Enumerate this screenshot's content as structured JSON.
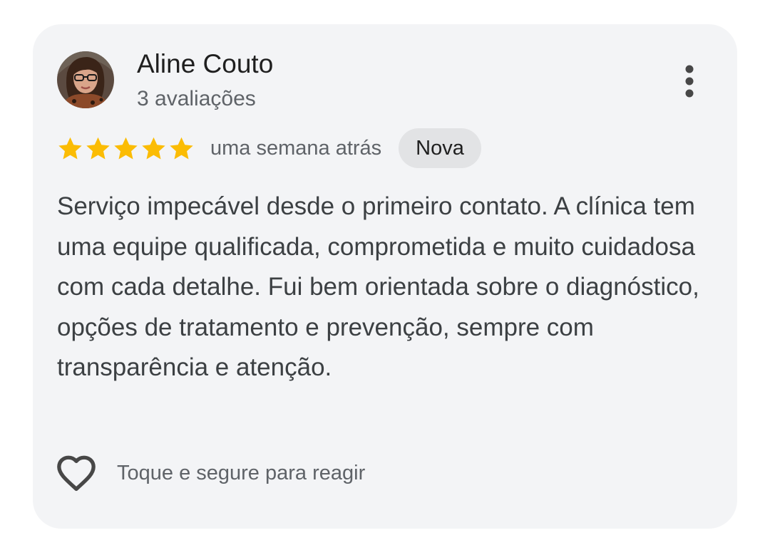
{
  "review": {
    "author": {
      "name": "Aline Couto",
      "review_count": "3 avaliações"
    },
    "rating": 5,
    "max_rating": 5,
    "date": "uma semana atrás",
    "badge": "Nova",
    "text": "Serviço impecável desde o primeiro contato. A clínica tem uma equipe qualificada, comprometida e muito cuidadosa com cada detalhe. Fui bem orientada sobre o diagnóstico, opções de tratamento e prevenção, sempre com transparência e atenção.",
    "react_hint": "Toque e segure para reagir"
  },
  "icons": {
    "more": "more-vert-icon",
    "star": "star-icon",
    "reaction": "heart-outline-icon"
  },
  "colors": {
    "card_background": "#f3f4f6",
    "star": "#fbbc04",
    "badge_background": "#e2e3e5",
    "primary_text": "#1f1f1f",
    "secondary_text": "#5f6368",
    "body_text": "#3c4043"
  }
}
